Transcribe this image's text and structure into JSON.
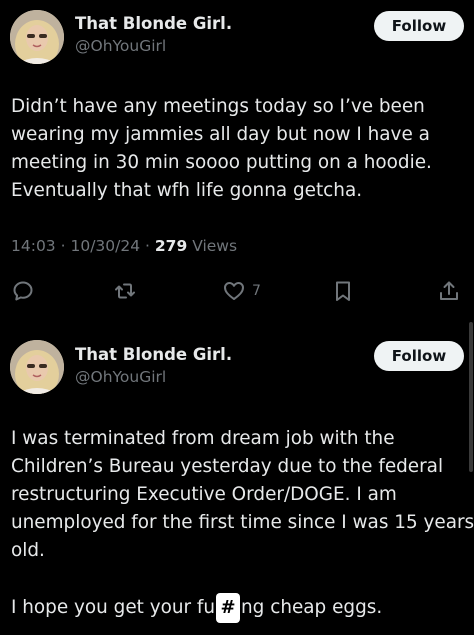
{
  "posts": [
    {
      "author_name": "That Blonde Girl.",
      "author_handle": "@OhYouGirl",
      "follow_label": "Follow",
      "body_lines": [
        "Didn’t have any meetings today so I’ve been",
        "wearing my jammies all day but now I have a",
        "meeting in 30 min soooo putting on a hoodie.",
        "Eventually that wfh life gonna getcha."
      ],
      "time": "14:03",
      "date": "10/30/24",
      "views_count": "279",
      "views_label": "Views",
      "like_count": "7",
      "icons": [
        "reply-icon",
        "retweet-icon",
        "like-icon",
        "bookmark-icon",
        "share-icon"
      ]
    },
    {
      "author_name": "That Blonde Girl.",
      "author_handle": "@OhYouGirl",
      "follow_label": "Follow",
      "body_lines": [
        "I was terminated from dream job with the",
        "Children’s Bureau yesterday due to the federal",
        "restructuring Executive Order/DOGE. I am",
        "unemployed for the first time since I was 15 years",
        "old."
      ],
      "second_para_before": "I hope you get your fu",
      "censor_glyph": "#",
      "second_para_after": "ng cheap eggs."
    }
  ],
  "colors": {
    "background": "#000000",
    "text": "#e7e9ea",
    "muted": "#71767b",
    "button_bg": "#eff3f4"
  }
}
